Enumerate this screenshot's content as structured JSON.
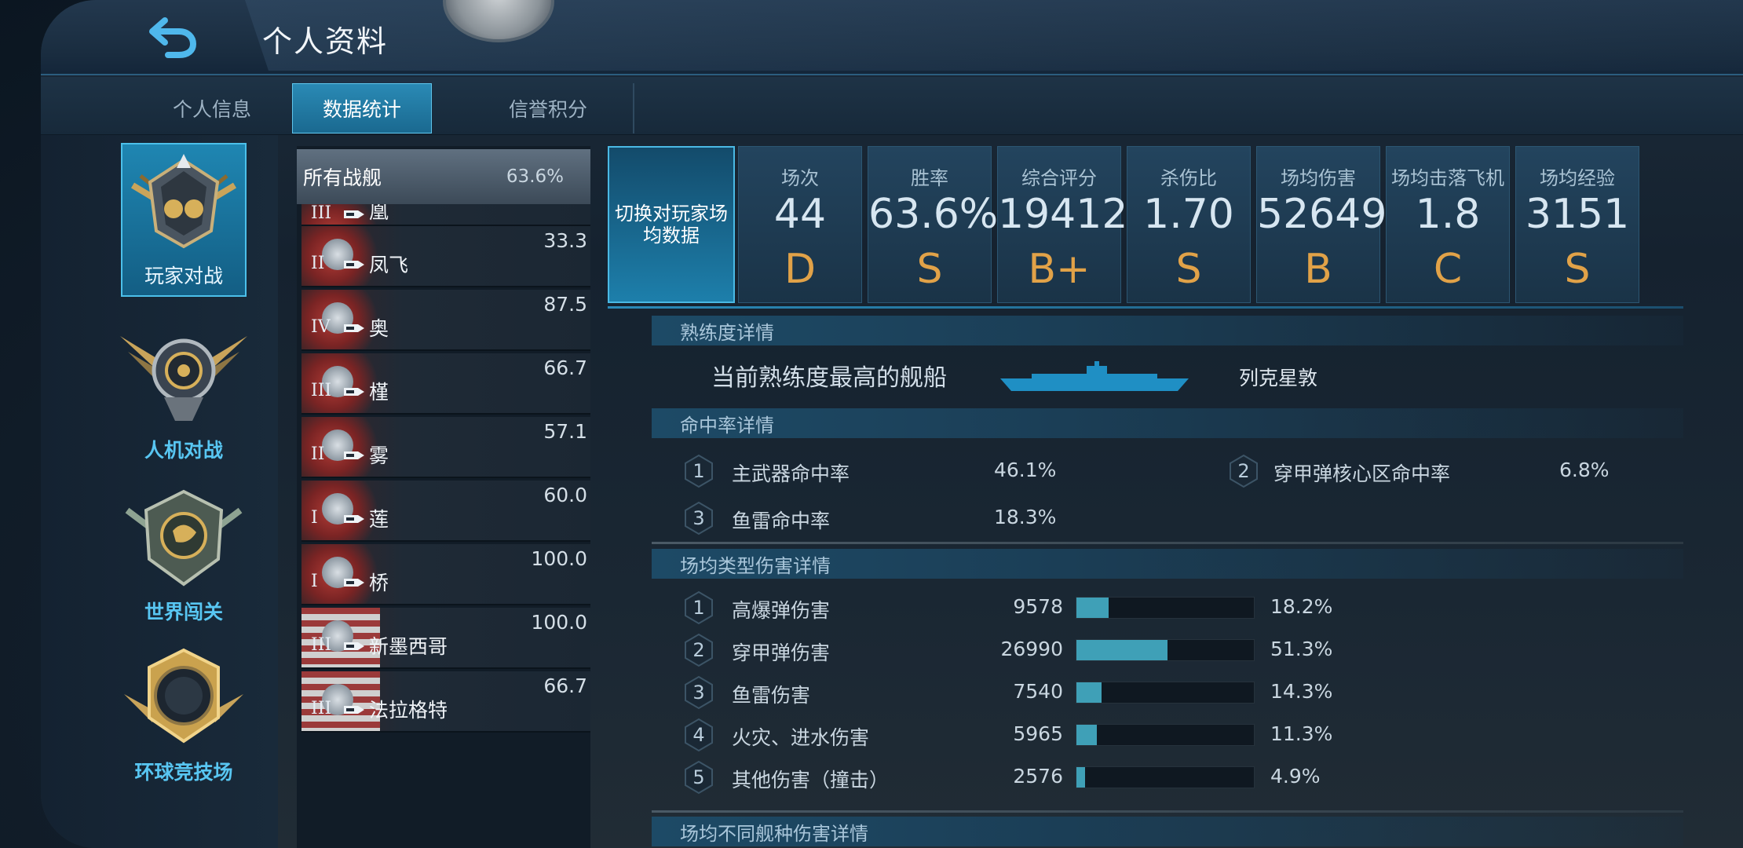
{
  "header": {
    "title": "个人资料",
    "back_icon": "back-arrow-icon"
  },
  "tabs": [
    {
      "label": "个人信息",
      "active": false
    },
    {
      "label": "数据统计",
      "active": true
    },
    {
      "label": "信誉积分",
      "active": false
    }
  ],
  "modes": [
    {
      "label": "玩家对战",
      "active": true
    },
    {
      "label": "人机对战",
      "active": false
    },
    {
      "label": "世界闯关",
      "active": false
    },
    {
      "label": "环球竞技场",
      "active": false
    }
  ],
  "ship_list": {
    "all": {
      "name": "所有战舰",
      "value": "63.6%"
    },
    "ships": [
      {
        "tier": "III",
        "name": "凰",
        "score": "",
        "flag": "cn"
      },
      {
        "tier": "II",
        "name": "凤飞",
        "score": "33.3",
        "flag": "cn"
      },
      {
        "tier": "IV",
        "name": "奥",
        "score": "87.5",
        "flag": "cn"
      },
      {
        "tier": "III",
        "name": "槿",
        "score": "66.7",
        "flag": "cn"
      },
      {
        "tier": "II",
        "name": "雾",
        "score": "57.1",
        "flag": "cn"
      },
      {
        "tier": "I",
        "name": "莲",
        "score": "60.0",
        "flag": "cn"
      },
      {
        "tier": "I",
        "name": "桥",
        "score": "100.0",
        "flag": "cn"
      },
      {
        "tier": "III",
        "name": "新墨西哥",
        "score": "100.0",
        "flag": "us"
      },
      {
        "tier": "III",
        "name": "法拉格特",
        "score": "66.7",
        "flag": "us"
      }
    ]
  },
  "stats": {
    "switch_label": "切换对玩家场均数据",
    "items": [
      {
        "label": "场次",
        "value": "44",
        "grade": "D"
      },
      {
        "label": "胜率",
        "value": "63.6%",
        "grade": "S"
      },
      {
        "label": "综合评分",
        "value": "19412",
        "grade": "B+"
      },
      {
        "label": "杀伤比",
        "value": "1.70",
        "grade": "S"
      },
      {
        "label": "场均伤害",
        "value": "52649",
        "grade": "B"
      },
      {
        "label": "场均击落飞机",
        "value": "1.8",
        "grade": "C"
      },
      {
        "label": "场均经验",
        "value": "3151",
        "grade": "S"
      }
    ]
  },
  "proficiency": {
    "header": "熟练度详情",
    "label": "当前熟练度最高的舰船",
    "ship_name": "列克星敦",
    "ship_color": "#1f8fc4"
  },
  "accuracy": {
    "header": "命中率详情",
    "items": [
      {
        "index": "1",
        "label": "主武器命中率",
        "value": "46.1%"
      },
      {
        "index": "2",
        "label": "穿甲弹核心区命中率",
        "value": "6.8%"
      },
      {
        "index": "3",
        "label": "鱼雷命中率",
        "value": "18.3%"
      }
    ]
  },
  "damage": {
    "header": "场均类型伤害详情",
    "items": [
      {
        "index": "1",
        "label": "高爆弹伤害",
        "value": "9578",
        "percent": "18.2%",
        "fraction": 0.182
      },
      {
        "index": "2",
        "label": "穿甲弹伤害",
        "value": "26990",
        "percent": "51.3%",
        "fraction": 0.513
      },
      {
        "index": "3",
        "label": "鱼雷伤害",
        "value": "7540",
        "percent": "14.3%",
        "fraction": 0.143
      },
      {
        "index": "4",
        "label": "火灾、进水伤害",
        "value": "5965",
        "percent": "11.3%",
        "fraction": 0.113
      },
      {
        "index": "5",
        "label": "其他伤害（撞击）",
        "value": "2576",
        "percent": "4.9%",
        "fraction": 0.049
      }
    ]
  },
  "shiptype_damage": {
    "header": "场均不同舰种伤害详情"
  },
  "colors": {
    "accent": "#1f86b2",
    "grade": "#e1a248",
    "bar_fill": "#3fa0b7"
  }
}
